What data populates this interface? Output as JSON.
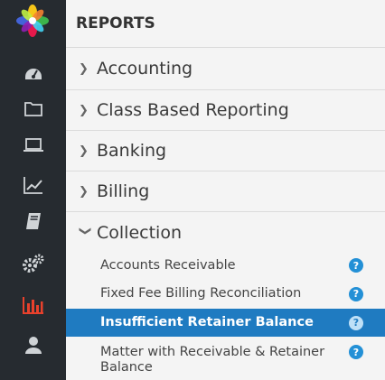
{
  "header": {
    "title": "REPORTS"
  },
  "categories": [
    {
      "label": "Accounting",
      "expanded": false
    },
    {
      "label": "Class Based Reporting",
      "expanded": false
    },
    {
      "label": "Banking",
      "expanded": false
    },
    {
      "label": "Billing",
      "expanded": false
    },
    {
      "label": "Collection",
      "expanded": true
    }
  ],
  "collection_items": [
    {
      "label": "Accounts Receivable",
      "help": "?"
    },
    {
      "label": "Fixed Fee Billing Reconciliation",
      "help": "?"
    },
    {
      "label": "Insufficient Retainer Balance",
      "help": "?",
      "active": true
    },
    {
      "label": "Matter with Receivable & Retainer Balance",
      "help": "?"
    }
  ],
  "rail_icons": [
    "app-logo",
    "dashboard-icon",
    "folder-icon",
    "laptop-icon",
    "trend-chart-icon",
    "book-icon",
    "gears-icon",
    "bar-chart-icon",
    "user-icon"
  ],
  "colors": {
    "rail": "#262b30",
    "active": "#1f7bc1",
    "accent_active_icon": "#e8412c"
  }
}
